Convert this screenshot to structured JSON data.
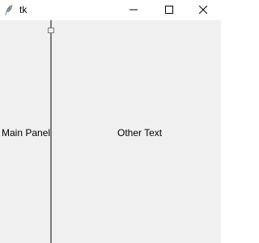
{
  "window": {
    "title": "tk",
    "icon": "feather-icon",
    "controls": [
      "minimize-icon",
      "maximize-icon",
      "close-icon"
    ]
  },
  "left_pane": {
    "label": "Main Panel"
  },
  "right_pane": {
    "label": "Other Text"
  },
  "colors": {
    "window_bg": "#f0f0f0",
    "titlebar_bg": "#ffffff",
    "sash": "#7a7a7a",
    "text": "#000000"
  }
}
